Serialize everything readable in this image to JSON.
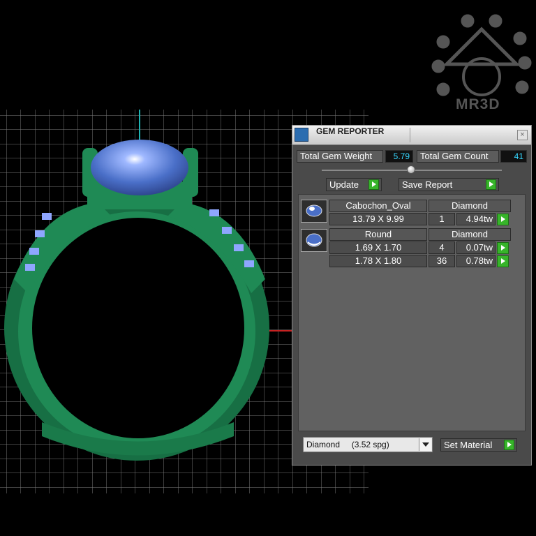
{
  "panel": {
    "title": "GEM REPORTER",
    "close_glyph": "×",
    "total_weight_label": "Total Gem Weight",
    "total_weight_value": "5.79",
    "total_count_label": "Total Gem Count",
    "total_count_value": "41",
    "update_label": "Update",
    "save_report_label": "Save Report",
    "gems": [
      {
        "shape": "Cabochon_Oval",
        "material": "Diamond",
        "thumb_icon": "oval-gem-icon",
        "rows": [
          {
            "size": "13.79 X 9.99",
            "count": "1",
            "weight": "4.94tw"
          }
        ]
      },
      {
        "shape": "Round",
        "material": "Diamond",
        "thumb_icon": "round-gem-icon",
        "rows": [
          {
            "size": "1.69 X 1.70",
            "count": "4",
            "weight": "0.07tw"
          },
          {
            "size": "1.78 X 1.80",
            "count": "36",
            "weight": "0.78tw"
          }
        ]
      }
    ],
    "material_select_value": "Diamond     (3.52 spg)",
    "set_material_label": "Set Material"
  },
  "watermark": {
    "text": "MR3D"
  },
  "colors": {
    "ring_green": "#1f8a55",
    "gem_blue": "#4a6fc8",
    "accent_green": "#37b42a",
    "value_cyan": "#36d7ff"
  }
}
